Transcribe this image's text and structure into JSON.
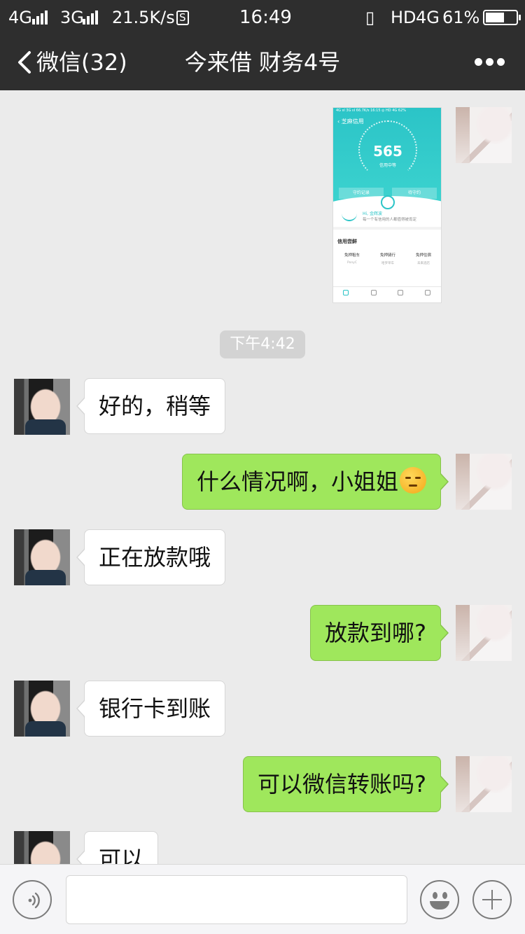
{
  "status_bar": {
    "network1": "4G",
    "network2": "3G",
    "speed": "21.5K/s",
    "s_icon": "S",
    "time": "16:49",
    "hd": "HD",
    "network3": "4G",
    "battery": "61%",
    "battery_level": 0.61
  },
  "nav": {
    "back_label": "微信(32)",
    "title": "今来借 财务4号",
    "icons": {
      "back": "chevron-left-icon",
      "more": "more-dots-icon"
    }
  },
  "thumbnail": {
    "status": "4G ııl 3G ııl 66.7K/s   16:15   ◎ HD 4G 62%",
    "title": "‹ 芝麻信用",
    "score": "565",
    "score_label": "信用中等",
    "tab_left": "守约记录",
    "tab_right": "待守约",
    "greeting": "Hi, 金辉波",
    "greeting_sub": "每一个有信用的人都值得被肯定",
    "section": "信用尝鲜",
    "items": [
      {
        "name": "免押租车",
        "sub": "PonyC"
      },
      {
        "name": "免押骑行",
        "sub": "哈罗单车"
      },
      {
        "name": "免押住宿",
        "sub": "未来酒店"
      }
    ]
  },
  "timestamp": "下午4:42",
  "messages": [
    {
      "side": "in",
      "text": "好的，稍等"
    },
    {
      "side": "out",
      "text": "什么情况啊，小姐姐"
    },
    {
      "side": "in",
      "text": "正在放款哦"
    },
    {
      "side": "out",
      "text": "放款到哪?"
    },
    {
      "side": "in",
      "text": "银行卡到账"
    },
    {
      "side": "out",
      "text": "可以微信转账吗?"
    },
    {
      "side": "in",
      "text": "可以"
    }
  ],
  "colors": {
    "header_bg": "#2e2e2e",
    "chat_bg": "#ebebeb",
    "out_bubble": "#9fe75c",
    "in_bubble": "#ffffff",
    "alipay_teal": "#2bc4c7"
  },
  "input_bar": {
    "icons": {
      "voice": "voice-icon",
      "emoji": "emoji-face-icon",
      "plus": "plus-icon"
    }
  }
}
